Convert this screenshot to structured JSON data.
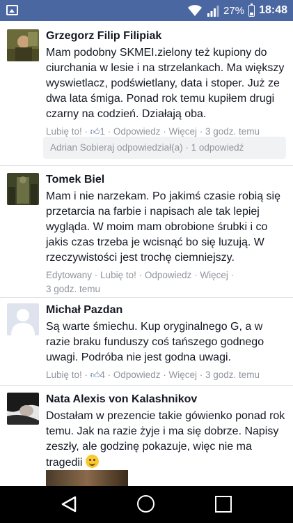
{
  "status_bar": {
    "battery": "27%",
    "time": "18:48",
    "icons": [
      "gallery-icon",
      "wifi-icon",
      "signal-icon",
      "battery-icon"
    ]
  },
  "comments": [
    {
      "name": "Grzegorz Filip Filipiak",
      "text": "Mam podobny SKMEI.zielony też kupiony do ciurchania w lesie i na strzelankach. Ma większy wyswietlacz, podświetlany, data i stoper. Już ze dwa lata śmiga. Ponad rok temu kupiłem drugi czarny na codzień. Działają oba.",
      "like": "Lubię to!",
      "likes": "1",
      "reply": "Odpowiedz",
      "more": "Więcej",
      "time": "3 godz. temu",
      "reply_summary": "Adrian Sobieraj odpowiedział(a) · 1 odpowiedź"
    },
    {
      "name": "Tomek Biel",
      "text": "Mam i nie narzekam. Po jakimś czasie robią się przetarcia na farbie i napisach ale tak lepiej wygląda. W moim mam obrobione śrubki i co jakis czas trzeba je wcisnąć bo się luzują. W rzeczywistości jest trochę ciemniejszy.",
      "edited": "Edytowany",
      "like": "Lubię to!",
      "reply": "Odpowiedz",
      "more": "Więcej",
      "time": "3 godz. temu"
    },
    {
      "name": "Michał Pazdan",
      "text": "Są warte śmiechu. Kup oryginalnego G, a w razie braku funduszy coś tańszego godnego uwagi. Podróba nie jest godna uwagi.",
      "like": "Lubię to!",
      "likes": "4",
      "reply": "Odpowiedz",
      "more": "Więcej",
      "time": "3 godz. temu"
    },
    {
      "name": "Nata Alexis von Kalashnikov",
      "text": "Dostałam w prezencie takie gówienko ponad rok temu. Jak na razie żyje i ma się dobrze. Napisy zeszły, ale godzinę pokazuje, więc nie ma tragedii"
    }
  ],
  "colors": {
    "status_bar": "#4b67a1",
    "name": "#141823",
    "meta": "#90949c",
    "separator": "#dddfe2"
  }
}
